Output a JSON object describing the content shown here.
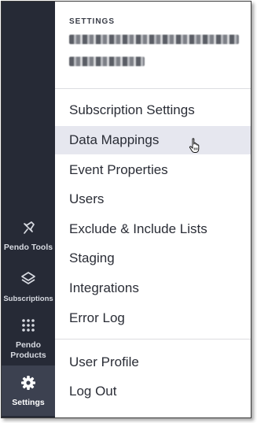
{
  "sidebar": {
    "items": [
      {
        "label": "Pendo Tools",
        "icon": "pin-icon"
      },
      {
        "label": "Subscriptions",
        "icon": "layers-icon"
      },
      {
        "label": "Pendo Products",
        "icon": "grid-dots-icon"
      },
      {
        "label": "Settings",
        "icon": "gear-icon",
        "active": true
      }
    ]
  },
  "menu": {
    "header": "SETTINGS",
    "account_name": "redacted",
    "main_items": [
      "Subscription Settings",
      "Data Mappings",
      "Event Properties",
      "Users",
      "Exclude & Include Lists",
      "Staging",
      "Integrations",
      "Error Log"
    ],
    "hovered_item": "Data Mappings",
    "user_items": [
      "User Profile",
      "Log Out"
    ]
  },
  "colors": {
    "sidebar_bg": "#262a36",
    "sidebar_active_bg": "#3c4150",
    "hover_bg": "#e6e7ef",
    "text": "#2a2d36"
  }
}
